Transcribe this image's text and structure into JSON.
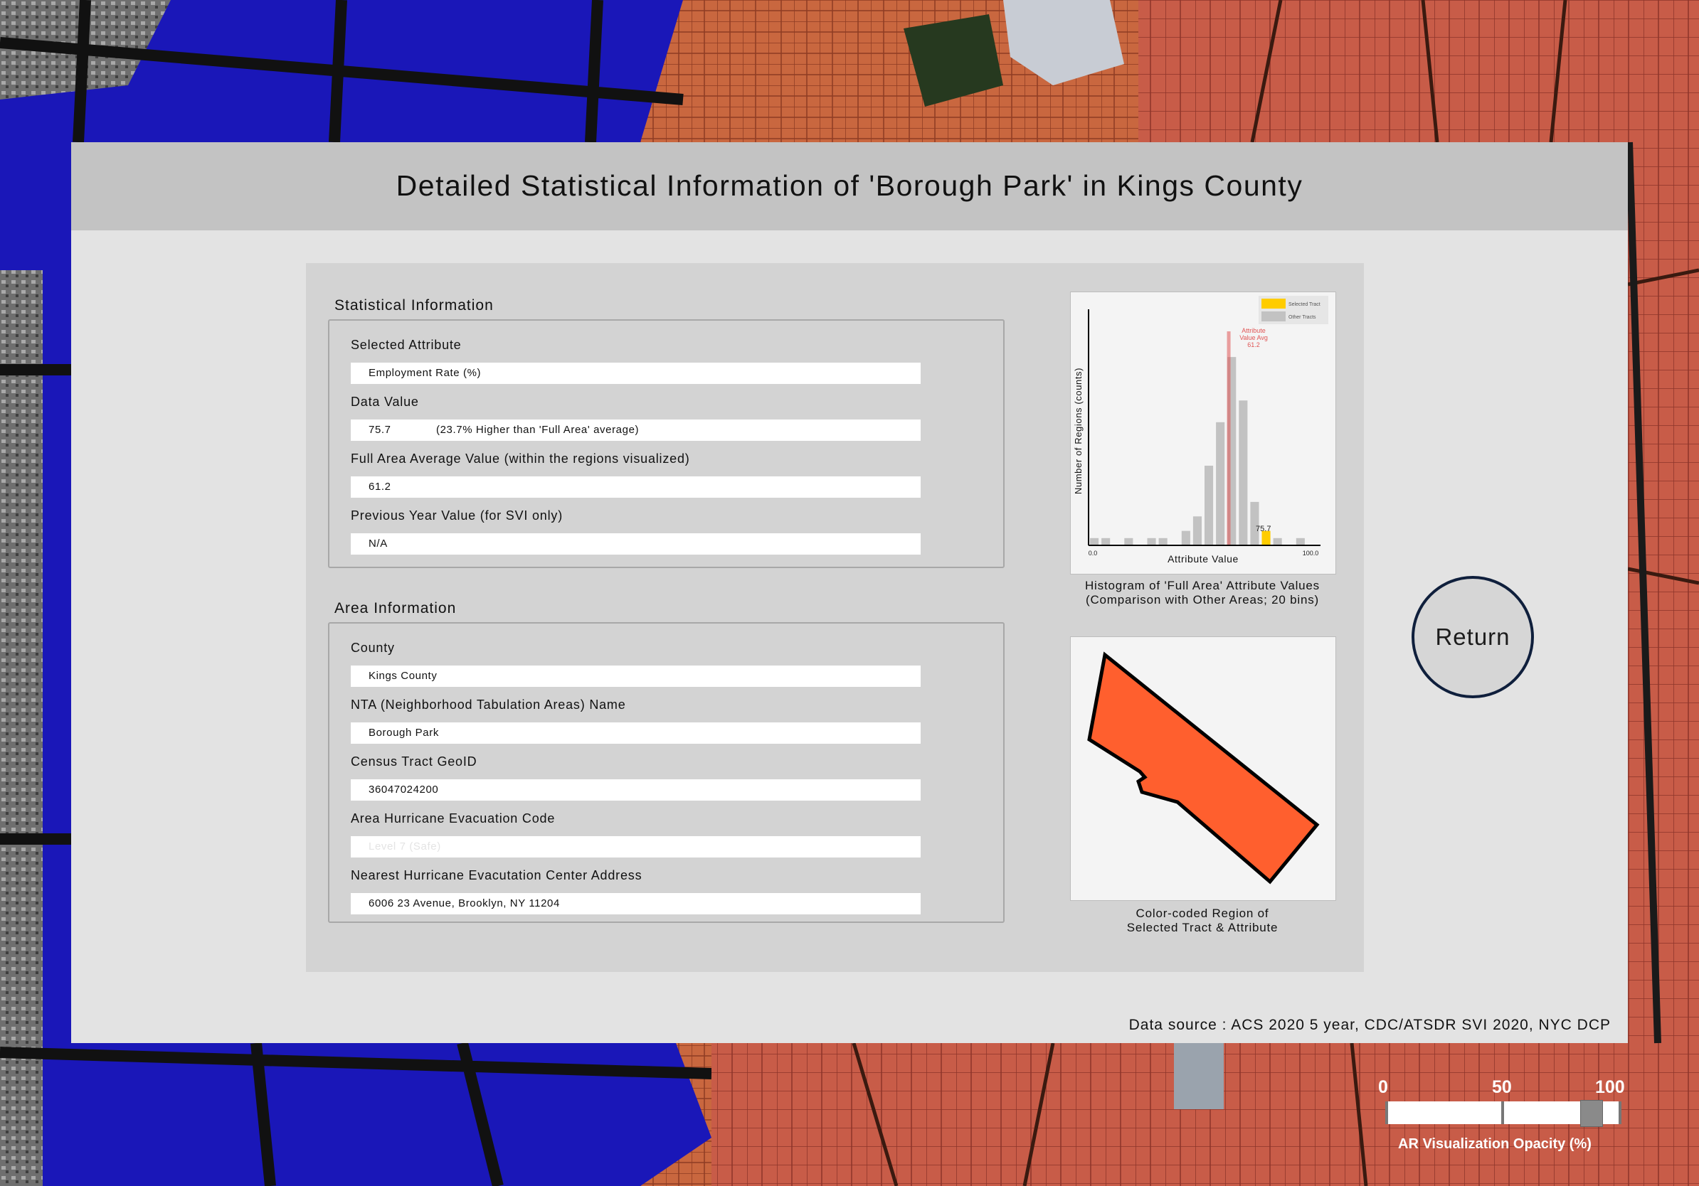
{
  "title": "Detailed Statistical Information of 'Borough Park' in Kings County",
  "statistical_information": {
    "heading": "Statistical Information",
    "selected_attribute": {
      "label": "Selected Attribute",
      "value": "Employment Rate (%)"
    },
    "data_value": {
      "label": "Data Value",
      "value": "75.7",
      "comparison": "(23.7% Higher than 'Full Area' average)"
    },
    "full_area_average": {
      "label": "Full Area Average Value (within the regions visualized)",
      "value": "61.2"
    },
    "previous_year": {
      "label": "Previous Year Value (for SVI only)",
      "value": "N/A"
    }
  },
  "area_information": {
    "heading": "Area Information",
    "county": {
      "label": "County",
      "value": "Kings County"
    },
    "nta_name": {
      "label": "NTA (Neighborhood Tabulation Areas) Name",
      "value": "Borough Park"
    },
    "census_tract": {
      "label": "Census Tract GeoID",
      "value": "36047024200"
    },
    "evacuation_code": {
      "label": "Area Hurricane Evacuation Code",
      "value": "Level 7 (Safe)"
    },
    "evacuation_center": {
      "label": "Nearest Hurricane Evacutation Center Address",
      "value": "6006 23 Avenue, Brooklyn, NY 11204"
    }
  },
  "histogram_caption": {
    "line1": "Histogram of 'Full Area' Attribute Values",
    "line2": "(Comparison with Other Areas; 20 bins)"
  },
  "region_caption": {
    "line1": "Color-coded Region of",
    "line2": "Selected Tract & Attribute"
  },
  "region_color": "#ff5f2e",
  "return_button": "Return",
  "data_source": "Data source : ACS 2020 5 year, CDC/ATSDR SVI 2020, NYC DCP",
  "opacity_slider": {
    "label": "AR Visualization Opacity (%)",
    "ticks": [
      "0",
      "50",
      "100"
    ],
    "value": 88
  },
  "colors": {
    "selected": "#ffcc00",
    "other": "#c2c2c2",
    "avg_line": "#e05555"
  },
  "chart_data": {
    "type": "bar",
    "xlabel": "Attribute Value",
    "ylabel": "Number of Regions (counts)",
    "xlim": [
      0.0,
      100.0
    ],
    "x_tick_labels": [
      "0.0",
      "100.0"
    ],
    "bin_width": 5,
    "series": [
      {
        "name": "Other Tracts",
        "values": [
          1,
          1,
          0,
          1,
          0,
          1,
          1,
          0,
          2,
          4,
          11,
          17,
          26,
          20,
          6,
          1,
          1,
          0,
          1,
          0
        ]
      },
      {
        "name": "Selected Tract",
        "values": [
          0,
          0,
          0,
          0,
          0,
          0,
          0,
          0,
          0,
          0,
          0,
          0,
          0,
          0,
          0,
          2,
          0,
          0,
          0,
          0
        ]
      }
    ],
    "ylim": [
      0,
      32
    ],
    "legend": [
      "Selected Tract",
      "Other Tracts"
    ],
    "legend_position": "top-right",
    "annotation": {
      "lines": [
        "Attribute",
        "Value Avg",
        "61.2"
      ],
      "x": 61.2
    },
    "selected_label": {
      "text": "75.7",
      "x": 75.7
    }
  }
}
